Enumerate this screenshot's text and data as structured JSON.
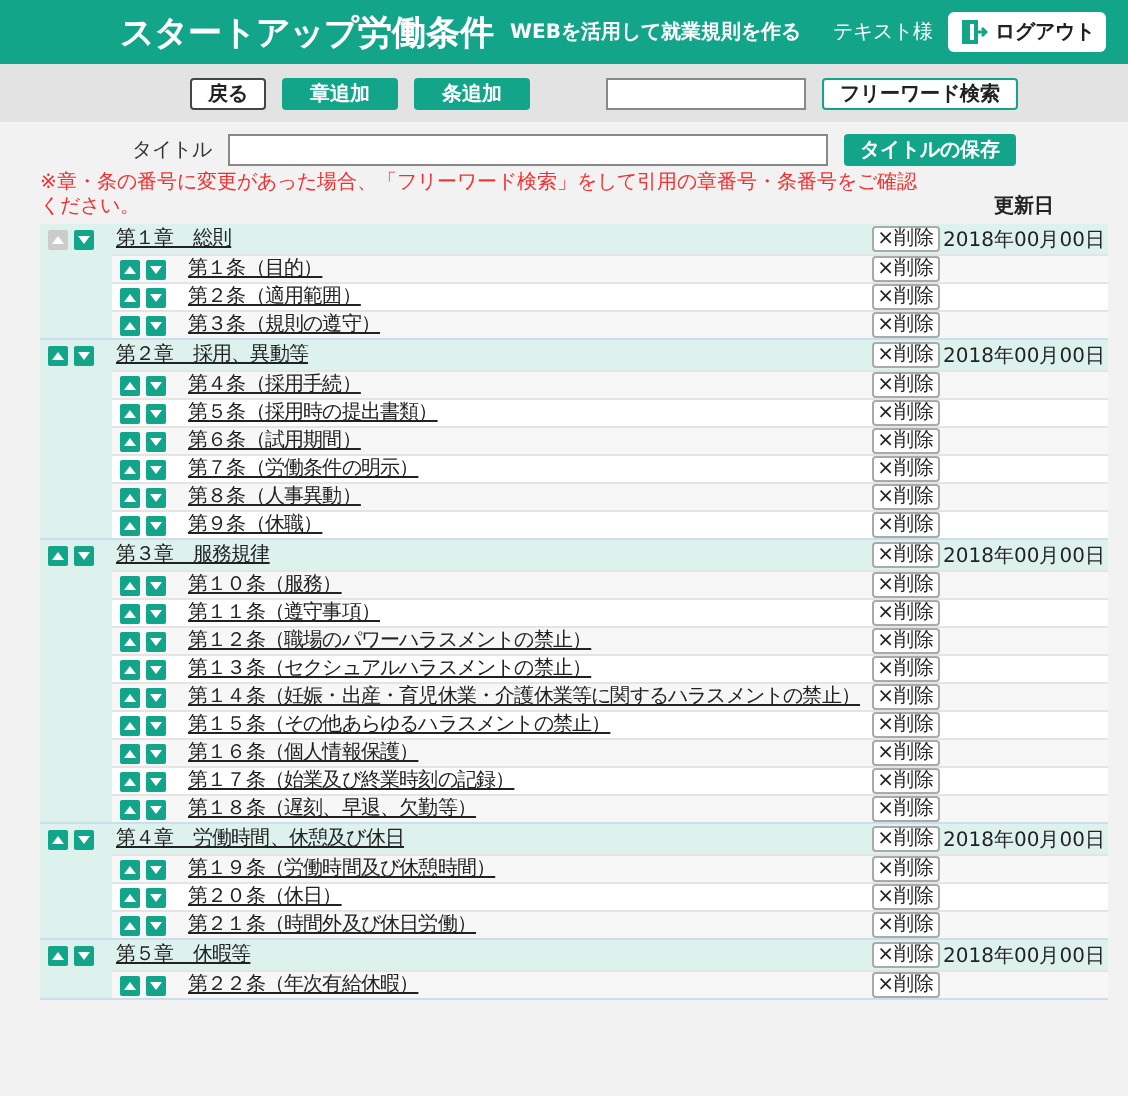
{
  "header": {
    "title": "スタートアップ労働条件",
    "subtitle": "WEBを活用して就業規則を作る",
    "user": "テキスト様",
    "logout": "ログアウト"
  },
  "toolbar": {
    "back": "戻る",
    "add_chapter": "章追加",
    "add_article": "条追加",
    "search_button": "フリーワード検索"
  },
  "title_form": {
    "label": "タイトル",
    "save": "タイトルの保存"
  },
  "notice": "※章・条の番号に変更があった場合、「フリーワード検索」をして引用の章番号・条番号をご確認ください。",
  "column_header": "更新日",
  "chapters": [
    {
      "title": "第１章　総則",
      "date": "2018年00月00日",
      "delete": "×削除",
      "up_disabled": true,
      "articles": [
        {
          "title": "第１条（目的）",
          "delete": "×削除",
          "up_disabled": false
        },
        {
          "title": "第２条（適用範囲）",
          "delete": "×削除",
          "up_disabled": false
        },
        {
          "title": "第３条（規則の遵守）",
          "delete": "×削除",
          "up_disabled": false
        }
      ]
    },
    {
      "title": "第２章　採用、異動等",
      "date": "2018年00月00日",
      "delete": "×削除",
      "up_disabled": false,
      "articles": [
        {
          "title": "第４条（採用手続）",
          "delete": "×削除",
          "up_disabled": false
        },
        {
          "title": "第５条（採用時の提出書類）",
          "delete": "×削除",
          "up_disabled": false
        },
        {
          "title": "第６条（試用期間）",
          "delete": "×削除",
          "up_disabled": false
        },
        {
          "title": "第７条（労働条件の明示）",
          "delete": "×削除",
          "up_disabled": false
        },
        {
          "title": "第８条（人事異動）",
          "delete": "×削除",
          "up_disabled": false
        },
        {
          "title": "第９条（休職）",
          "delete": "×削除",
          "up_disabled": false
        }
      ]
    },
    {
      "title": "第３章　服務規律",
      "date": "2018年00月00日",
      "delete": "×削除",
      "up_disabled": false,
      "articles": [
        {
          "title": "第１０条（服務）",
          "delete": "×削除",
          "up_disabled": false
        },
        {
          "title": "第１１条（遵守事項）",
          "delete": "×削除",
          "up_disabled": false
        },
        {
          "title": "第１２条（職場のパワーハラスメントの禁止）",
          "delete": "×削除",
          "up_disabled": false
        },
        {
          "title": "第１３条（セクシュアルハラスメントの禁止）",
          "delete": "×削除",
          "up_disabled": false
        },
        {
          "title": "第１４条（妊娠・出産・育児休業・介護休業等に関するハラスメントの禁止）",
          "delete": "×削除",
          "up_disabled": false
        },
        {
          "title": "第１５条（その他あらゆるハラスメントの禁止）",
          "delete": "×削除",
          "up_disabled": false
        },
        {
          "title": "第１６条（個人情報保護）",
          "delete": "×削除",
          "up_disabled": false
        },
        {
          "title": "第１７条（始業及び終業時刻の記録）",
          "delete": "×削除",
          "up_disabled": false
        },
        {
          "title": "第１８条（遅刻、早退、欠勤等）",
          "delete": "×削除",
          "up_disabled": false
        }
      ]
    },
    {
      "title": "第４章　労働時間、休憩及び休日",
      "date": "2018年00月00日",
      "delete": "×削除",
      "up_disabled": false,
      "articles": [
        {
          "title": "第１９条（労働時間及び休憩時間）",
          "delete": "×削除",
          "up_disabled": false
        },
        {
          "title": "第２０条（休日）",
          "delete": "×削除",
          "up_disabled": false
        },
        {
          "title": "第２１条（時間外及び休日労働）",
          "delete": "×削除",
          "up_disabled": false
        }
      ]
    },
    {
      "title": "第５章　休暇等",
      "date": "2018年00月00日",
      "delete": "×削除",
      "up_disabled": false,
      "articles": [
        {
          "title": "第２２条（年次有給休暇）",
          "delete": "×削除",
          "up_disabled": false
        }
      ]
    }
  ]
}
